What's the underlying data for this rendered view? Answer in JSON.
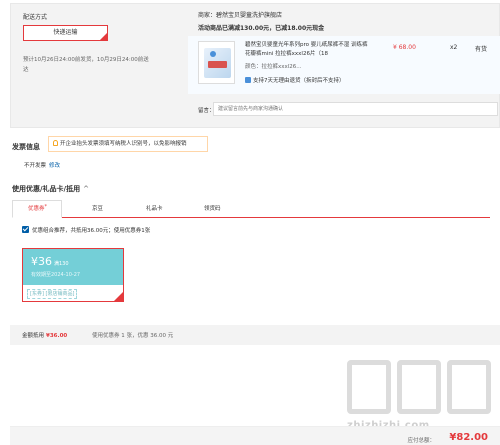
{
  "delivery": {
    "title": "配送方式",
    "button_label": "快递运输",
    "ship_note": "预计10月26日24:00前发货，10月29日24:00前送达"
  },
  "seller": {
    "label": "商家：",
    "name": "碧然宝贝婴童洗护旗舰店",
    "promo": "活动商品已满减130.00元，已减18.00元现金"
  },
  "item": {
    "name": "碧然宝贝婴童光年系列pro 婴儿纸尿裤不湿 训练裤花瓣裤mini 拉拉裤xxxl26片（18",
    "color": "颜色：拉拉裤xxxl26...",
    "support": "支持7天无理由退货（拆封后不支持）",
    "price": "¥ 68.00",
    "qty": "x2",
    "stock": "有货"
  },
  "remark": {
    "label": "留言：",
    "placeholder": "建议留言前先与商家沟通确认"
  },
  "invoice": {
    "title": "发票信息",
    "hint": "开企业抬头发票须填写纳税人识别号，以免影响报销",
    "status": "不开发票",
    "edit_label": "修改"
  },
  "coupon": {
    "title": "使用优惠/礼品卡/抵用",
    "chevron": "^",
    "tabs": [
      {
        "label": "优惠券",
        "star": "*"
      },
      {
        "label": "京豆"
      },
      {
        "label": "礼品卡"
      },
      {
        "label": "领货码"
      }
    ],
    "combo_text": "优惠组合推荐，共抵用36.00元；使用优惠券1张",
    "card": {
      "amount": "¥36",
      "condition": "满130",
      "expire": "有效期至2024-10-27",
      "scope": "[东券] [限店铺商品]"
    },
    "summary_label": "金额抵用",
    "summary_amount": "¥36.00",
    "summary_detail": "使用优惠券 1 张，优惠 36.00 元"
  },
  "totals": {
    "rows": [
      "¥",
      "¥",
      "¥",
      "¥"
    ]
  },
  "pay": {
    "label": "应付总额：",
    "amount": "¥82.00"
  },
  "watermark": {
    "text": "zhizhizhi.com"
  },
  "colors": {
    "accent": "#e4393c",
    "coupon": "#74cfd7",
    "link": "#005ea7"
  }
}
